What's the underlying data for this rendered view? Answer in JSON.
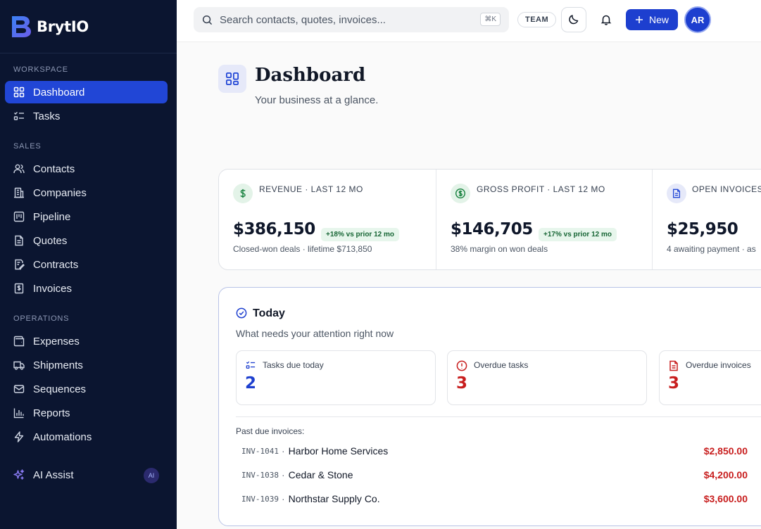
{
  "brand": {
    "name": "BrytIO"
  },
  "sidebar": {
    "sections": {
      "workspace": "WORKSPACE",
      "sales": "SALES",
      "operations": "OPERATIONS"
    },
    "items": {
      "dashboard": "Dashboard",
      "tasks": "Tasks",
      "contacts": "Contacts",
      "companies": "Companies",
      "pipeline": "Pipeline",
      "quotes": "Quotes",
      "contracts": "Contracts",
      "invoices": "Invoices",
      "expenses": "Expenses",
      "shipments": "Shipments",
      "sequences": "Sequences",
      "reports": "Reports",
      "automations": "Automations",
      "ai_assist": "AI Assist"
    },
    "ai_badge": "AI",
    "active": "dashboard"
  },
  "topbar": {
    "search_placeholder": "Search contacts, quotes, invoices...",
    "shortcut": "⌘K",
    "team_label": "TEAM",
    "new_label": "New",
    "avatar_initials": "AR"
  },
  "page": {
    "title": "Dashboard",
    "subtitle": "Your business at a glance."
  },
  "stats": [
    {
      "label": "REVENUE · LAST 12 MO",
      "value": "$386,150",
      "delta": "+18% vs prior 12 mo",
      "sub": "Closed-won deals · lifetime $713,850"
    },
    {
      "label": "GROSS PROFIT · LAST 12 MO",
      "value": "$146,705",
      "delta": "+17% vs prior 12 mo",
      "sub": "38% margin on won deals"
    },
    {
      "label": "OPEN INVOICES",
      "value": "$25,950",
      "sub": "4 awaiting payment · as"
    }
  ],
  "today": {
    "title": "Today",
    "subtitle": "What needs your attention right now",
    "cards": [
      {
        "label": "Tasks due today",
        "value": "2"
      },
      {
        "label": "Overdue tasks",
        "value": "3"
      },
      {
        "label": "Overdue invoices",
        "value": "3"
      }
    ],
    "past_due_label": "Past due invoices:",
    "invoices": [
      {
        "id": "INV-1041",
        "client": "Harbor Home Services",
        "amount": "$2,850.00"
      },
      {
        "id": "INV-1038",
        "client": "Cedar & Stone",
        "amount": "$4,200.00"
      },
      {
        "id": "INV-1039",
        "client": "Northstar Supply Co.",
        "amount": "$3,600.00"
      }
    ]
  },
  "colors": {
    "sidebar_bg": "#0b1530",
    "accent": "#1d3fcf",
    "danger": "#c81e1e",
    "success": "#166534"
  }
}
